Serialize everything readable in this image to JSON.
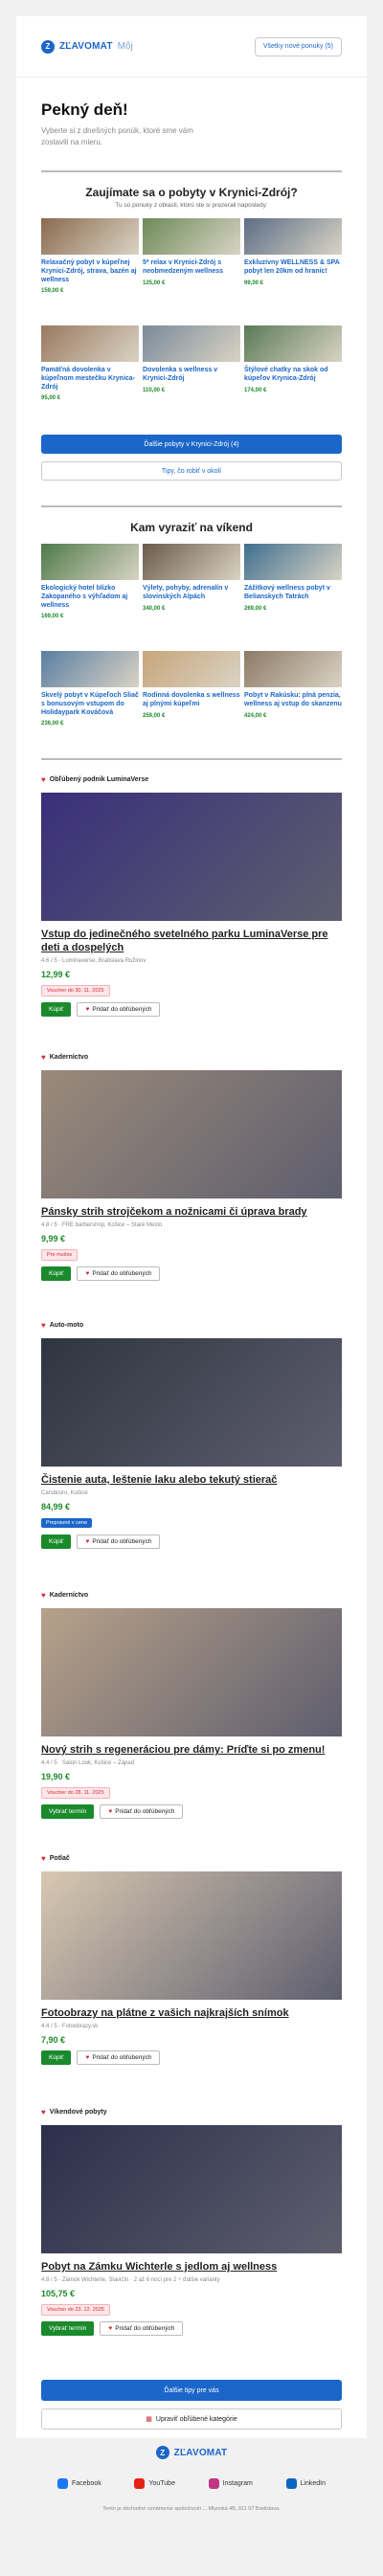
{
  "header": {
    "logo_mark": "Z",
    "logo_text": "ZĽAVOMAT",
    "logo_sub": "Môj",
    "all_offers_button": "Všetky nové ponuky (5)"
  },
  "greeting": {
    "title": "Pekný deň!",
    "text": "Vyberte si z dnešných ponúk, ktoré sme vám zostavili na mieru."
  },
  "section_krynica": {
    "title": "Zaujímate sa o pobyty v Krynici-Zdrój?",
    "subtitle": "Tu sú ponuky z oblasti, ktorú ste si prezerali naposledy:",
    "tiles": [
      {
        "title": "Relaxačný pobyt v kúpeľnej Krynici-Zdrój, strava, bazén aj wellness",
        "price": "159,00 €",
        "color": "#8a6a4f"
      },
      {
        "title": "5* relax v Krynici-Zdrój s neobmedzeným wellness",
        "price": "125,00 €",
        "color": "#6d8a5a"
      },
      {
        "title": "Exkluzívny WELLNESS & SPA pobyt len 20km od hraníc!",
        "price": "99,00 €",
        "color": "#5d6e86"
      },
      {
        "title": "Pamäťná dovolenka v kúpeľnom mestečku Krynica-Zdrój",
        "price": "95,00 €",
        "color": "#9a7860"
      },
      {
        "title": "Dovolenka s wellness v Krynici-Zdrój",
        "price": "110,00 €",
        "color": "#7a8a9a"
      },
      {
        "title": "Štýlové chatky na skok od kúpeľov Krynica-Zdrój",
        "price": "174,00 €",
        "color": "#5a7a56"
      }
    ],
    "more_button": "Ďalšie pobyty v Krynici-Zdrój (4)",
    "tips_button": "Tipy, čo robiť v okolí"
  },
  "section_weekend": {
    "title": "Kam vyraziť na víkend",
    "tiles": [
      {
        "title": "Ekologický hotel blízko Zakopaného s výhľadom aj wellness",
        "price": "169,00 €",
        "color": "#4e7a4a"
      },
      {
        "title": "Výlety, pohyby, adrenalín v slovinských Alpách",
        "price": "340,00 €",
        "color": "#6a5a4a"
      },
      {
        "title": "Zážitkový wellness pobyt v Belianskych Tatrách",
        "price": "269,00 €",
        "color": "#3f6f8f"
      },
      {
        "title": "Skvelý pobyt v Kúpeľoch Sliač s bonusovým vstupom do Holidaypark Kováčová",
        "price": "236,00 €",
        "color": "#5a7ea2"
      },
      {
        "title": "Rodinná dovolenka s wellness aj plnými kúpeľmi",
        "price": "259,00 €",
        "color": "#c7a57a"
      },
      {
        "title": "Pobyt v Rakúsku: plná penzia, wellness aj vstup do skanzenu",
        "price": "424,00 €",
        "color": "#8c7a66"
      }
    ]
  },
  "deals": [
    {
      "category": "Obľúbený podnik LuminaVerse",
      "title": "Vstup do jedinečného svetelného parku LuminaVerse pre deti a dospelých",
      "location": "4.6 / 5 · Luminaverse, Bratislava Ružinov",
      "price": "12,99 €",
      "badge": "Voucher do 30. 11. 2025",
      "badge_type": "red",
      "action": "Kúpiť",
      "fav": "Pridať do obľúbených",
      "color": "#3a2f7a"
    },
    {
      "category": "Kaderníctvo",
      "title": "Pánsky strih strojčekom a nožnicami či úprava brady",
      "location": "4.8 / 5 · FRE barbershop, Košice – Staré Mesto",
      "price": "9,99 €",
      "badge": "Pre mužov",
      "badge_type": "red",
      "action": "Kúpiť",
      "fav": "Pridať do obľúbených",
      "color": "#9a8a7a"
    },
    {
      "category": "Auto-moto",
      "title": "Čistenie auta, leštenie laku alebo tekutý stierač",
      "location": "Carsbistro, Košice",
      "price": "84,99 €",
      "badge": "Prepravné v cene",
      "badge_type": "blue",
      "action": "Kúpiť",
      "fav": "Pridať do obľúbených",
      "color": "#2e3540"
    },
    {
      "category": "Kaderníctvo",
      "title": "Nový strih s regeneráciou pre dámy: Príďte si po zmenu!",
      "location": "4.4 / 5 · Salon Look, Košice – Západ",
      "price": "19,90 €",
      "badge": "Voucher do 28. 11. 2025",
      "badge_type": "red",
      "action": "Vybrať termín",
      "fav": "Pridať do obľúbených",
      "color": "#b7a18a"
    },
    {
      "category": "Potlač",
      "title": "Fotoobrazy na plátne z vašich najkrajších snímok",
      "location": "4.4 / 5 · Fotoobrazy.sk",
      "price": "7,90 €",
      "badge": "",
      "badge_type": "",
      "action": "Kúpiť",
      "fav": "Pridať do obľúbených",
      "color": "#d8c8b2"
    },
    {
      "category": "Víkendové pobyty",
      "title": "Pobyt na Zámku Wichterle s jedlom aj wellness",
      "location": "4.8 / 5 · Zámok Wichterle, Slavičín · 2 až 6 nocí pre 2 ÷ ďalšie varianty",
      "price": "105,75 €",
      "badge": "Voucher do 23. 12. 2025",
      "badge_type": "red",
      "action": "Vybrať termín",
      "fav": "Pridať do obľúbených",
      "color": "#2b2f4a"
    }
  ],
  "bottom": {
    "more_tips_button": "Ďalšie tipy pre vás",
    "edit_categories_button": "Upraviť obľúbené kategórie"
  },
  "footer": {
    "logo_text": "ZĽAVOMAT",
    "social": [
      {
        "label": "Facebook",
        "color": "#1877f2"
      },
      {
        "label": "YouTube",
        "color": "#e62117"
      },
      {
        "label": "Instagram",
        "color": "#c13584"
      },
      {
        "label": "LinkedIn",
        "color": "#0a66c2"
      }
    ],
    "address": "Tento je obchodné oznámenie spoločnosti ... Mlynská 4B, 811 07 Bratislava."
  }
}
